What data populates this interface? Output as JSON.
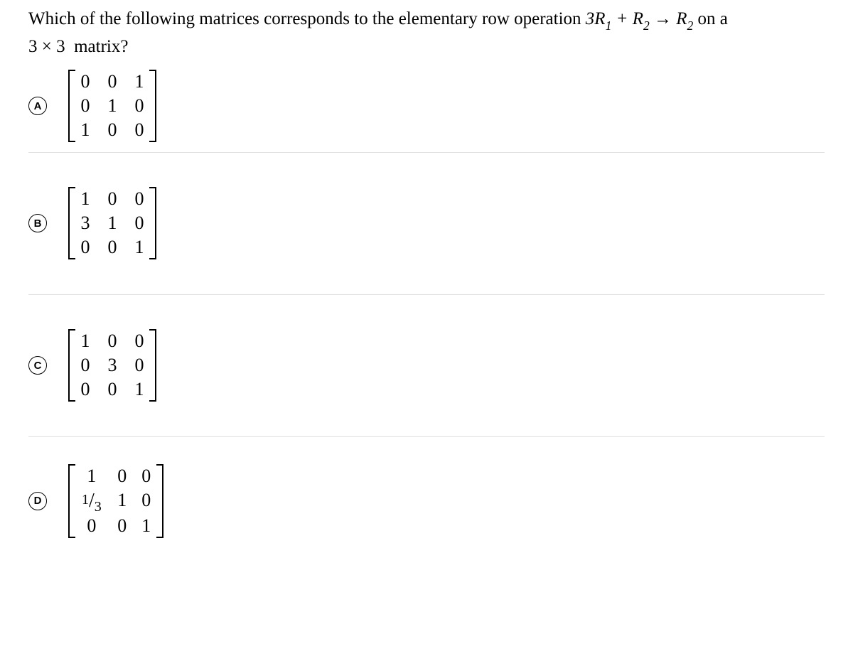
{
  "question": {
    "prefix": "Which of the following matrices corresponds to the elementary row operation ",
    "operation": "3R₁ + R₂ → R₂",
    "suffix": " on a 3 × 3 matrix?"
  },
  "options": [
    {
      "label": "A",
      "matrix": [
        [
          "0",
          "0",
          "1"
        ],
        [
          "0",
          "1",
          "0"
        ],
        [
          "1",
          "0",
          "0"
        ]
      ]
    },
    {
      "label": "B",
      "matrix": [
        [
          "1",
          "0",
          "0"
        ],
        [
          "3",
          "1",
          "0"
        ],
        [
          "0",
          "0",
          "1"
        ]
      ]
    },
    {
      "label": "C",
      "matrix": [
        [
          "1",
          "0",
          "0"
        ],
        [
          "0",
          "3",
          "0"
        ],
        [
          "0",
          "0",
          "1"
        ]
      ]
    },
    {
      "label": "D",
      "matrix": [
        [
          "1",
          "0",
          "0"
        ],
        [
          "1/3",
          "1",
          "0"
        ],
        [
          "0",
          "0",
          "1"
        ]
      ]
    }
  ]
}
